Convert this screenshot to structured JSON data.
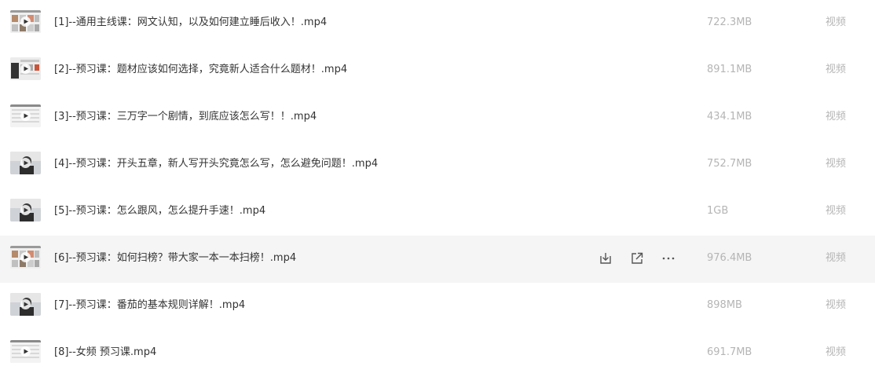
{
  "files": [
    {
      "name": "[1]--通用主线课：网文认知，以及如何建立睡后收入！.mp4",
      "size": "722.3MB",
      "type": "视频",
      "thumb": "collage"
    },
    {
      "name": "[2]--预习课：题材应该如何选择，究竟新人适合什么题材！.mp4",
      "size": "891.1MB",
      "type": "视频",
      "thumb": "collage-dark"
    },
    {
      "name": "[3]--预习课：三万字一个剧情，到底应该怎么写！！.mp4",
      "size": "434.1MB",
      "type": "视频",
      "thumb": "screen"
    },
    {
      "name": "[4]--预习课：开头五章，新人写开头究竟怎么写，怎么避免问题！.mp4",
      "size": "752.7MB",
      "type": "视频",
      "thumb": "person"
    },
    {
      "name": "[5]--预习课：怎么跟风，怎么提升手速！.mp4",
      "size": "1GB",
      "type": "视频",
      "thumb": "person"
    },
    {
      "name": "[6]--预习课：如何扫榜？带大家一本一本扫榜！.mp4",
      "size": "976.4MB",
      "type": "视频",
      "thumb": "collage"
    },
    {
      "name": "[7]--预习课：番茄的基本规则详解！.mp4",
      "size": "898MB",
      "type": "视频",
      "thumb": "person"
    },
    {
      "name": "[8]--女频 预习课.mp4",
      "size": "691.7MB",
      "type": "视频",
      "thumb": "screen"
    }
  ],
  "hovered_row": 6,
  "row_actions": [
    {
      "icon": "download-icon"
    },
    {
      "icon": "share-icon"
    },
    {
      "icon": "more-icon"
    }
  ],
  "colors": {
    "hover_bg": "#f5f5f5",
    "muted_text": "#b5b5b5",
    "name_text": "#333333"
  }
}
